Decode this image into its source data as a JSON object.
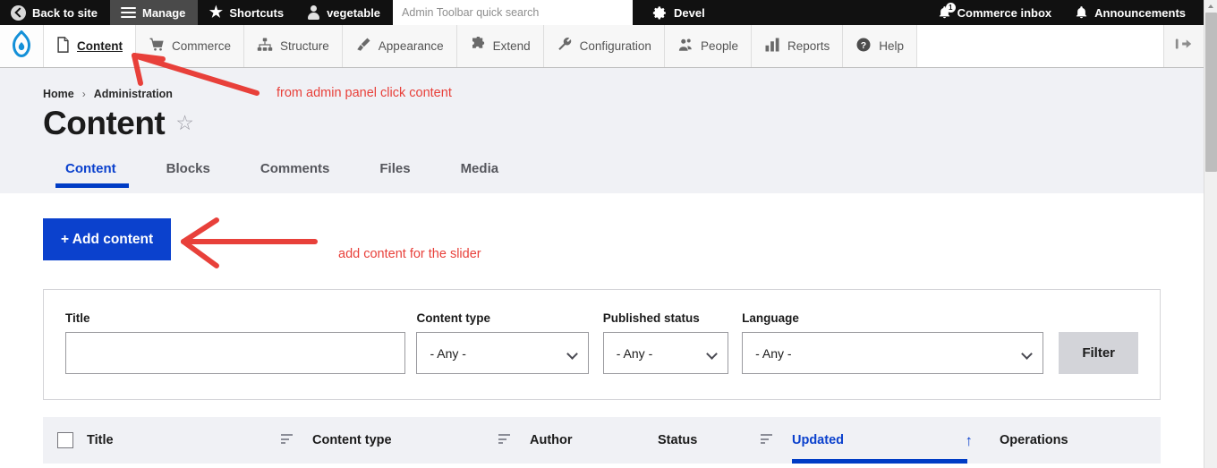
{
  "toolbar_top": {
    "items": [
      {
        "label": "Back to site",
        "icon": "back-arrow-icon",
        "active": false
      },
      {
        "label": "Manage",
        "icon": "hamburger-icon",
        "active": true
      },
      {
        "label": "Shortcuts",
        "icon": "star-icon",
        "active": false
      },
      {
        "label": "vegetable",
        "icon": "user-icon",
        "active": false
      }
    ],
    "search": {
      "placeholder": "Admin Toolbar quick search",
      "value": ""
    },
    "right_items": [
      {
        "label": "Devel",
        "icon": "gear-icon",
        "badge": ""
      },
      {
        "label": "Commerce inbox",
        "icon": "bell-icon",
        "badge": "1"
      },
      {
        "label": "Announcements",
        "icon": "bell-icon",
        "badge": ""
      }
    ]
  },
  "admin_menu": {
    "logo": "drupal-droplet-logo",
    "items": [
      {
        "label": "Content",
        "icon": "page-icon",
        "active": true
      },
      {
        "label": "Commerce",
        "icon": "cart-icon",
        "active": false
      },
      {
        "label": "Structure",
        "icon": "structure-icon",
        "active": false
      },
      {
        "label": "Appearance",
        "icon": "paintbrush-icon",
        "active": false
      },
      {
        "label": "Extend",
        "icon": "puzzle-icon",
        "active": false
      },
      {
        "label": "Configuration",
        "icon": "wrench-icon",
        "active": false
      },
      {
        "label": "People",
        "icon": "people-icon",
        "active": false
      },
      {
        "label": "Reports",
        "icon": "bar-chart-icon",
        "active": false
      },
      {
        "label": "Help",
        "icon": "question-icon",
        "active": false
      }
    ],
    "collapse_icon": "collapse-toolbar-icon"
  },
  "page_header": {
    "breadcrumb": [
      "Home",
      "Administration"
    ],
    "breadcrumb_separator": "›",
    "title": "Content",
    "bookmark_icon": "star-outline-icon"
  },
  "tabs": [
    {
      "label": "Content",
      "active": true
    },
    {
      "label": "Blocks",
      "active": false
    },
    {
      "label": "Comments",
      "active": false
    },
    {
      "label": "Files",
      "active": false
    },
    {
      "label": "Media",
      "active": false
    }
  ],
  "actions": {
    "add_content_label": "+ Add content"
  },
  "filters": {
    "title": {
      "label": "Title",
      "value": "",
      "placeholder": ""
    },
    "content_type": {
      "label": "Content type",
      "value": "- Any -"
    },
    "published_status": {
      "label": "Published status",
      "value": "- Any -"
    },
    "language": {
      "label": "Language",
      "value": "- Any -"
    },
    "filter_button": "Filter"
  },
  "table": {
    "columns": [
      {
        "label": "Title",
        "sortable": true,
        "active_sort": false
      },
      {
        "label": "Content type",
        "sortable": true,
        "active_sort": false
      },
      {
        "label": "Author",
        "sortable": false,
        "active_sort": false
      },
      {
        "label": "Status",
        "sortable": true,
        "active_sort": false
      },
      {
        "label": "Updated",
        "sortable": true,
        "active_sort": true,
        "sort_direction": "↑"
      },
      {
        "label": "Operations",
        "sortable": false,
        "active_sort": false
      }
    ],
    "select_all": false
  },
  "annotations": [
    {
      "text": "from admin panel click content",
      "color": "#e8403a"
    },
    {
      "text": "add content for the slider",
      "color": "#e8403a"
    }
  ],
  "colors": {
    "toolbar_bg": "#111111",
    "toolbar_active": "#4a4a4a",
    "menu_bg": "#f7f7f7",
    "header_bg": "#f0f1f5",
    "primary_blue": "#0b41cd",
    "accent_underline": "#003cc5",
    "drupal_logo_blue": "#1490d8",
    "annotation_red": "#e8403a",
    "filter_button_bg": "#d3d4d9"
  }
}
